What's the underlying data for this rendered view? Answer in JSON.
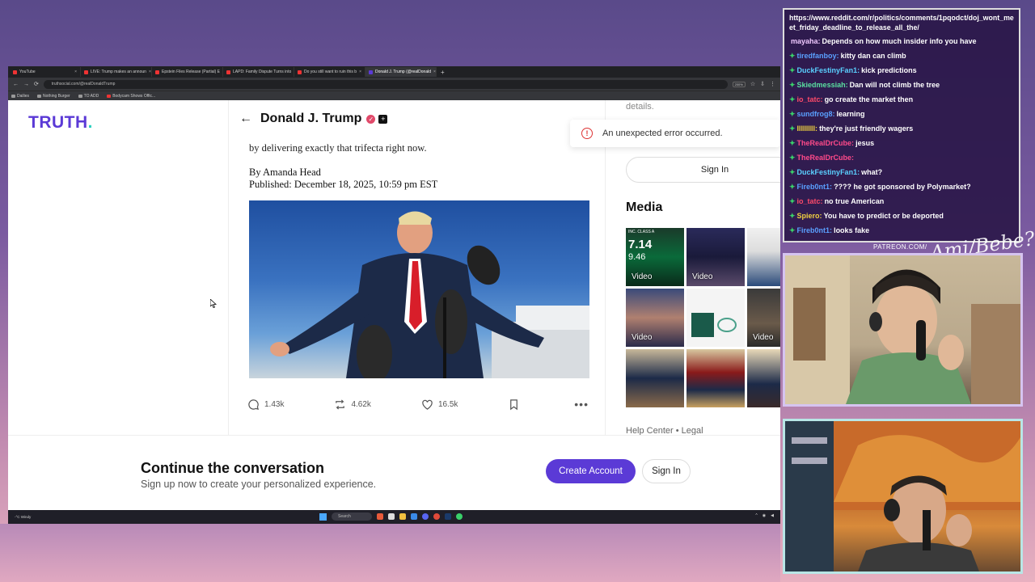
{
  "browser": {
    "tabs": [
      {
        "label": "YouTube",
        "active": false
      },
      {
        "label": "LIVE: Trump makes an announ",
        "active": false
      },
      {
        "label": "Epstein Files Release (Partial) E",
        "active": false
      },
      {
        "label": "LAPD: Family Dispute Turns into",
        "active": false
      },
      {
        "label": "Do you still want to ruin this b",
        "active": false
      },
      {
        "label": "Donald J. Trump (@realDonald",
        "active": true
      }
    ],
    "new_tab": "+",
    "url": "truthsocial.com/@realDonaldTrump",
    "zoom": "200%",
    "bookmarks": [
      "Dailies",
      "Nothing Burger",
      "TO ADD",
      "Bodycam Shows Offic..."
    ]
  },
  "page": {
    "logo": {
      "text": "TRUTH",
      "dot": "."
    },
    "header": {
      "back": "←",
      "name": "Donald J. Trump",
      "verified": "✓",
      "plus": "+"
    },
    "article": {
      "faded_line": "",
      "line": "by delivering exactly that trifecta right now.",
      "author": "By Amanda Head",
      "published": "Published: December 18, 2025, 10:59 pm EST"
    },
    "actions": {
      "replies": "1.43k",
      "retruths": "4.62k",
      "likes": "16.5k"
    },
    "sidebar": {
      "details": "details.",
      "error": "An unexpected error occurred.",
      "sign_in": "Sign In",
      "media_title": "Media",
      "video_label": "Video",
      "thumb_text_1": "7.14",
      "thumb_text_2": "9.46",
      "thumb_text_3": "INC. CLASS A",
      "footer": "Help Center • Legal"
    },
    "cta": {
      "title": "Continue the conversation",
      "subtitle": "Sign up now to create your personalized experience.",
      "create_account": "Create Account",
      "sign_in": "Sign In"
    }
  },
  "taskbar": {
    "weather": "-°C Windy",
    "search": "Search"
  },
  "chat": {
    "url": "https://www.reddit.com/r/politics/comments/1pqodct/doj_wont_meet_friday_deadline_to_release_all_the/",
    "messages": [
      {
        "user": "mayaha:",
        "text": "Depends on how much insider info you have",
        "color": "#f0c8ff",
        "badge": "",
        "emote": ""
      },
      {
        "user": "tiredfanboy:",
        "text": "kitty dan can climb",
        "color": "#5aa0ff",
        "badge": "✦",
        "emote": ""
      },
      {
        "user": "DuckFestinyFan1:",
        "text": "kick predictions",
        "color": "#5ad0ff",
        "badge": "✦",
        "emote": ""
      },
      {
        "user": "Skiedmessiah:",
        "text": "Dan will not climb the tree",
        "color": "#5ae0a0",
        "badge": "✦",
        "emote": ""
      },
      {
        "user": "io_tatc:",
        "text": "go create the market then",
        "color": "#ff4a6a",
        "badge": "✦",
        "emote": ""
      },
      {
        "user": "sundfrog8:",
        "text": "learning",
        "color": "#5aa0ff",
        "badge": "✦",
        "emote": ""
      },
      {
        "user": "IIIIIIIII:",
        "text": "they're just friendly wagers",
        "color": "#f0d040",
        "badge": "✦",
        "emote": ""
      },
      {
        "user": "TheRealDrCube:",
        "text": "jesus",
        "color": "#ff4a8a",
        "badge": "✦",
        "emote": ""
      },
      {
        "user": "TheRealDrCube:",
        "text": "",
        "color": "#ff4a8a",
        "badge": "✦",
        "emote": ""
      },
      {
        "user": "DuckFestinyFan1:",
        "text": "what?",
        "color": "#5ad0ff",
        "badge": "✦",
        "emote": ""
      },
      {
        "user": "Fireb0nt1:",
        "text": "???? he got sponsored by Polymarket?",
        "color": "#5aa0ff",
        "badge": "✦",
        "emote": ""
      },
      {
        "user": "io_tatc:",
        "text": "no true American",
        "color": "#ff4a6a",
        "badge": "✦",
        "emote": ""
      },
      {
        "user": "Spiero:",
        "text": "You have to predict or be deported",
        "color": "#f0d040",
        "badge": "✦",
        "emote": ""
      },
      {
        "user": "Fireb0nt1:",
        "text": "looks fake",
        "color": "#5aa0ff",
        "badge": "✦",
        "emote": ""
      }
    ]
  },
  "stream": {
    "patreon": "PATREON.COM/",
    "brand": "Ami/Bebe?"
  }
}
